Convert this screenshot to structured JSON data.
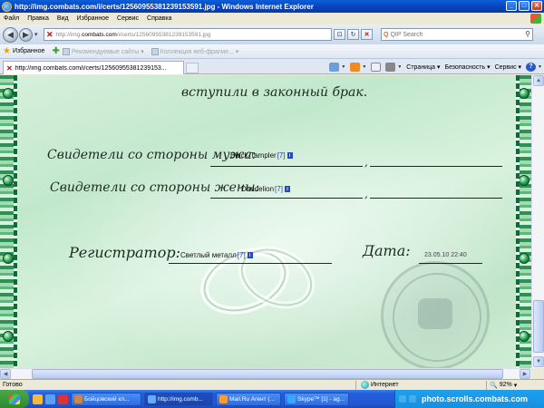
{
  "window": {
    "title": "http://img.combats.com/i/certs/12560955381239153591.jpg - Windows Internet Explorer"
  },
  "menu": [
    "Файл",
    "Правка",
    "Вид",
    "Избранное",
    "Сервис",
    "Справка"
  ],
  "address": {
    "prefix": "http://img.",
    "domain": "combats.com",
    "path": "/i/certs/12560955381239153591.jpg"
  },
  "search": {
    "placeholder": "QIP Search"
  },
  "favorites": {
    "label": "Избранное",
    "items": [
      "Рекомендуемые сайты ▾",
      "Коллекция веб-фрагме... ▾"
    ]
  },
  "tab": {
    "label": "http://img.combats.com/i/certs/12560955381239153..."
  },
  "commands": {
    "page": "Страница",
    "safety": "Безопасность",
    "tools": "Сервис"
  },
  "certificate": {
    "header_text": "вступили в законный брак.",
    "witness_husband_label": "Свидетели со стороны мужа:",
    "witness_husband_name": "Black-Tampler",
    "witness_husband_level": "[7]",
    "witness_wife_label": "Свидетели со стороны жены:",
    "witness_wife_name": "Dandelion",
    "witness_wife_level": "[7]",
    "registrar_label": "Регистратор:",
    "registrar_name": "Светлый металл",
    "registrar_level": "[7]",
    "date_label": "Дата:",
    "date_value": "23.05.10 22:40",
    "comma": ","
  },
  "status": {
    "text": "Готово",
    "zone": "Интернет",
    "zoom": "92%"
  },
  "taskbar": {
    "tasks": [
      "Бойцовский кл...",
      "http://img.comb...",
      "Mail.Ru Агент (...",
      "Skype™ [1] - ag..."
    ],
    "watermark": "photo.scrolls.combats.com"
  },
  "colors": {
    "accent": "#0a5fd8",
    "certificate_bg": "#c8ecd2",
    "border_green": "#2f8f55"
  }
}
